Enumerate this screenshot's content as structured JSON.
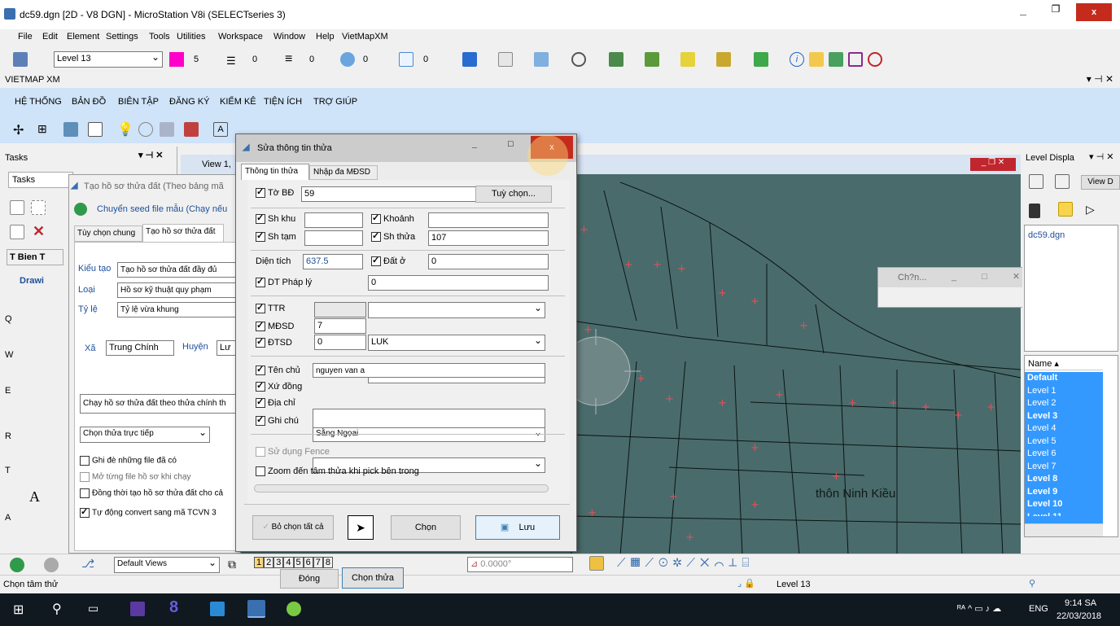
{
  "app": {
    "title": "dc59.dgn [2D - V8 DGN] - MicroStation V8i (SELECTseries 3)",
    "menu": [
      "File",
      "Edit",
      "Element",
      "Settings",
      "Tools",
      "Utilities",
      "Workspace",
      "Window",
      "Help",
      "VietMapXM"
    ],
    "level": "Level 13"
  },
  "attr": {
    "color": "5",
    "style": "0",
    "weight": "0",
    "trans": "0",
    "prio": "0"
  },
  "vietmap": {
    "title": "VIETMAP XM",
    "menu": [
      "HỆ THỐNG",
      "BẢN ĐỒ",
      "BIÊN TẬP",
      "ĐĂNG KÝ",
      "KIỂM KÊ",
      "TIỆN ÍCH",
      "TRỢ GIÚP"
    ]
  },
  "tasks": {
    "title": "Tasks",
    "tab": "Tasks",
    "item1": "T Bien T",
    "item2": "Drawi"
  },
  "back_dlg": {
    "title": "Tạo hồ sơ thửa đất (Theo bảng mã",
    "seed": "Chuyển seed file mẫu (Chạy nếu",
    "tab1": "Tùy chọn chung",
    "tab2": "Tạo hồ sơ thửa đất",
    "kieu_label": "Kiểu tạo",
    "kieu_value": "Tạo hồ sơ thửa đất đầy đủ",
    "loai_label": "Loại",
    "loai_value": "Hồ sơ kỹ thuật quy phạm",
    "tyle_label": "Tỷ lệ",
    "tyle_value": "Tỷ lệ vừa khung",
    "xa_label": "Xã",
    "xa_value": "Trung Chính",
    "huyen_label": "Huyện",
    "huyen_value": "Lư",
    "chay_label": "Chạy hồ sơ thửa đất theo thửa chính th",
    "chon_value": "Chọn thửa trực tiếp",
    "opt1": "Ghi đè những file đã có",
    "opt2": "Mở từng file hồ sơ khi chạy",
    "opt3": "Đồng thời tạo hồ sơ thửa đất cho cả",
    "opt4": "Tự động convert sang mã TCVN 3",
    "dong": "Đóng",
    "chonthua": "Chọn thửa"
  },
  "dlg": {
    "title": "Sửa thông tin thửa",
    "tab1": "Thông tin thửa",
    "tab2": "Nhập đa MĐSD",
    "tobd_label": "Tờ BĐ",
    "tobd_value": "59",
    "tuychon": "Tuỳ chọn...",
    "shkhu": "Sh khu",
    "khoanh": "Khoảnh",
    "shtam": "Sh tạm",
    "shthua": "Sh thửa",
    "shthua_value": "107",
    "dientich_label": "Diện tích",
    "dientich_value": "637.5",
    "datro": "Đất ở",
    "datro_value": "0",
    "dtphaply": "DT Pháp lý",
    "dtphaply_value": "0",
    "ttr": "TTR",
    "mdsd": "MĐSD",
    "mdsd_value": "7",
    "mdsd_code": "LUK",
    "dtsd": "ĐTSD",
    "dtsd_value": "0",
    "tenchu": "Tên chủ",
    "tenchu_value": "nguyen van a",
    "xudong": "Xứ đồng",
    "xudong_value": "Sằng Ngọai",
    "diachi": "Địa chỉ",
    "ghichu": "Ghi chú",
    "fence": "Sử dụng Fence",
    "zoom": "Zoom đến tâm thửa khi pick bên trong",
    "bochon": "Bỏ chọn tất cả",
    "chon": "Chọn",
    "luu": "Lưu"
  },
  "view": {
    "title": "View 1,",
    "place": "thôn Ninh Kiều"
  },
  "chon_float": {
    "title": "Ch?n..."
  },
  "level_panel": {
    "title": "Level Displa",
    "view_btn": "View D",
    "file": "dc59.dgn",
    "header": "Name",
    "levels": [
      "Default",
      "Level 1",
      "Level 2",
      "Level 3",
      "Level 4",
      "Level 5",
      "Level 6",
      "Level 7",
      "Level 8",
      "Level 9",
      "Level 10",
      "Level 11"
    ]
  },
  "bottom": {
    "views": "Default Views",
    "nums": [
      "1",
      "2",
      "3",
      "4",
      "5",
      "6",
      "7",
      "8"
    ],
    "angle": "0.0000°",
    "status": "Chọn tâm thử",
    "level_status": "Level 13"
  },
  "taskbar": {
    "lang": "ENG",
    "time": "9:14 SA",
    "date": "22/03/2018"
  },
  "colors": {
    "map": "#4a6b6b",
    "selected": "#3399ff",
    "title_blue": "#cfe3f9"
  }
}
